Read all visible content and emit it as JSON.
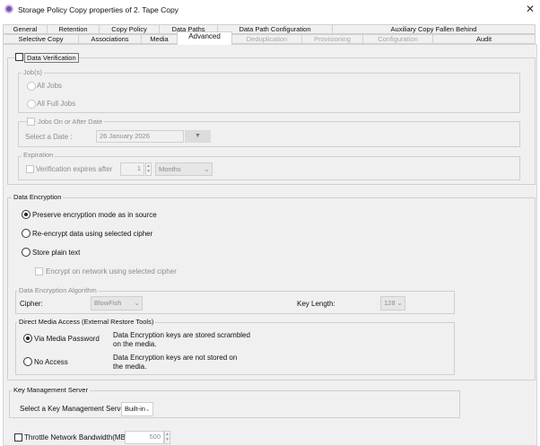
{
  "window": {
    "title": "Storage Policy Copy properties of 2. Tape Copy",
    "close": "✕"
  },
  "tabs_row1": [
    "General",
    "Retention",
    "Copy Policy",
    "Data Paths",
    "Data Path Configuration",
    "Auxiliary Copy Fallen Behind"
  ],
  "tabs_row2": [
    "Selective Copy",
    "Associations",
    "Media",
    "Advanced",
    "Deduplication",
    "Provisioning",
    "Configuration",
    "Audit"
  ],
  "verification": {
    "label": "Data Verification",
    "jobs_label": "Job(s)",
    "all_jobs": "All Jobs",
    "all_full_jobs": "All Full Jobs",
    "date_group": "Jobs On or After Date",
    "select_date": "Select a Date :",
    "date_value": "26 January 2026",
    "expiration_label": "Expiration",
    "expires_after": "Verification expires after",
    "expires_value": "1",
    "expires_unit": "Months"
  },
  "encryption": {
    "label": "Data Encryption",
    "preserve": "Preserve encryption mode as in source",
    "reencrypt": "Re-encrypt data using selected cipher",
    "plain": "Store plain text",
    "network": "Encrypt on network using selected cipher",
    "algo_label": "Data Encryption Algorithm",
    "cipher_label": "Cipher:",
    "cipher_value": "BlowFish",
    "keylen_label": "Key Length:",
    "keylen_value": "128",
    "dma_label": "Direct Media Access (External Restore Tools)",
    "via_password": "Via Media Password",
    "via_password_desc1": "Data Encryption keys are stored scrambled",
    "via_password_desc2": "on the media.",
    "no_access": "No Access",
    "no_access_desc1": "Data Encryption keys are not stored on",
    "no_access_desc2": "the media."
  },
  "kms": {
    "label": "Key Management Server",
    "select_label": "Select a Key Management Server:",
    "value": "Built-in"
  },
  "throttle": {
    "label": "Throttle Network Bandwidth(MB/HR)",
    "value": "500"
  }
}
